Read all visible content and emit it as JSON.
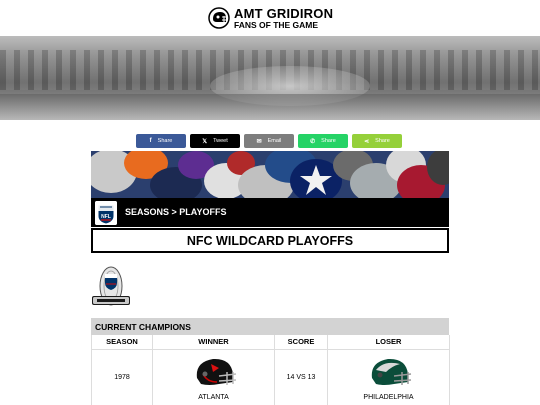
{
  "header": {
    "title": "AMT GRIDIRON",
    "tagline": "FANS OF THE GAME"
  },
  "share": [
    {
      "label": "Share",
      "icon": "facebook-icon",
      "color": "#3b5998"
    },
    {
      "label": "Tweet",
      "icon": "x-icon",
      "color": "#000000"
    },
    {
      "label": "Email",
      "icon": "email-icon",
      "color": "#7d7d7d"
    },
    {
      "label": "Share",
      "icon": "whatsapp-icon",
      "color": "#25d366"
    },
    {
      "label": "Share",
      "icon": "share-icon",
      "color": "#95d03a"
    }
  ],
  "breadcrumb": "SEASONS > PLAYOFFS",
  "page_title": "NFC WILDCARD PLAYOFFS",
  "champions": {
    "heading": "CURRENT CHAMPIONS",
    "columns": [
      "SEASON",
      "WINNER",
      "SCORE",
      "LOSER"
    ],
    "row": {
      "season": "1978",
      "winner": "ATLANTA",
      "score": "14 VS 13",
      "loser": "PHILADELPHIA"
    }
  }
}
